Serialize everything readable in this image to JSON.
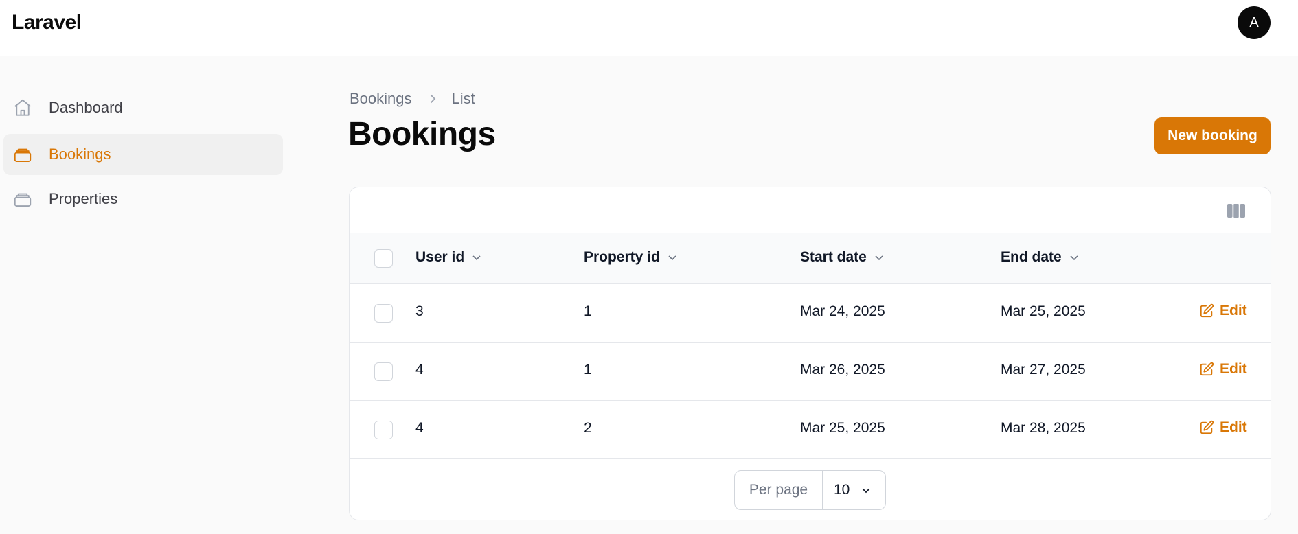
{
  "app": {
    "brand": "Laravel",
    "user_initial": "A",
    "accent_color": "#d97706"
  },
  "sidebar": {
    "items": [
      {
        "label": "Dashboard",
        "icon": "home-icon",
        "active": false
      },
      {
        "label": "Bookings",
        "icon": "stack-icon",
        "active": true
      },
      {
        "label": "Properties",
        "icon": "stack-icon",
        "active": false
      }
    ]
  },
  "breadcrumb": {
    "items": [
      "Bookings",
      "List"
    ],
    "separator_icon": "chevron-right-icon"
  },
  "page": {
    "title": "Bookings",
    "new_button_label": "New booking"
  },
  "table": {
    "toolbar_icon": "columns-icon",
    "columns": [
      {
        "label": "User id",
        "sortable": true
      },
      {
        "label": "Property id",
        "sortable": true
      },
      {
        "label": "Start date",
        "sortable": true
      },
      {
        "label": "End date",
        "sortable": true
      }
    ],
    "rows": [
      {
        "user_id": "3",
        "property_id": "1",
        "start_date": "Mar 24, 2025",
        "end_date": "Mar 25, 2025",
        "action": "Edit"
      },
      {
        "user_id": "4",
        "property_id": "1",
        "start_date": "Mar 26, 2025",
        "end_date": "Mar 27, 2025",
        "action": "Edit"
      },
      {
        "user_id": "4",
        "property_id": "2",
        "start_date": "Mar 25, 2025",
        "end_date": "Mar 28, 2025",
        "action": "Edit"
      }
    ],
    "pagination": {
      "per_page_label": "Per page",
      "per_page_value": "10"
    }
  }
}
